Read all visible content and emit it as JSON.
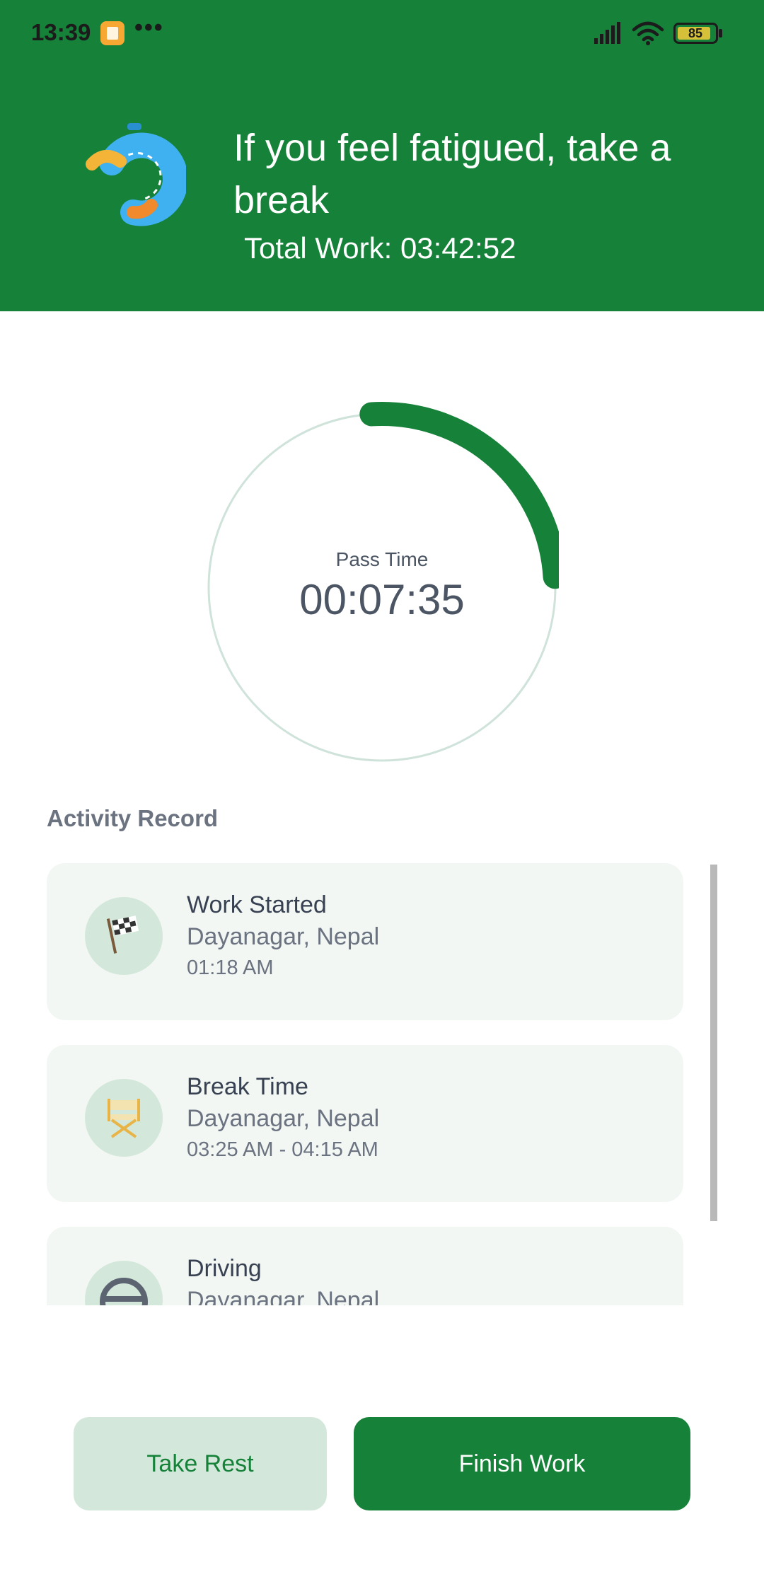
{
  "status_bar": {
    "time": "13:39",
    "dots": "•••",
    "battery": "85",
    "icons": [
      "app-notification-icon",
      "signal-icon",
      "wifi-icon",
      "battery-icon"
    ]
  },
  "header": {
    "headline": "If you feel fatigued, take a break",
    "total_work": "Total Work: 03:42:52",
    "background_color": "#168139"
  },
  "timer": {
    "label": "Pass Time",
    "value": "00:07:35",
    "progress_fraction": 0.25,
    "ring_color": "#168139",
    "track_color": "#cfe3da"
  },
  "activity": {
    "title": "Activity Record",
    "items": [
      {
        "title": "Work Started",
        "location": "Dayanagar, Nepal",
        "time": "01:18 AM",
        "icon": "checkered-flag-icon"
      },
      {
        "title": "Break Time",
        "location": "Dayanagar, Nepal",
        "time": "03:25 AM - 04:15 AM",
        "icon": "directors-chair-icon"
      },
      {
        "title": "Driving",
        "location": "Dayanagar, Nepal",
        "time": "",
        "icon": "steering-wheel-icon"
      }
    ]
  },
  "actions": {
    "take_rest": "Take Rest",
    "finish_work": "Finish Work"
  }
}
